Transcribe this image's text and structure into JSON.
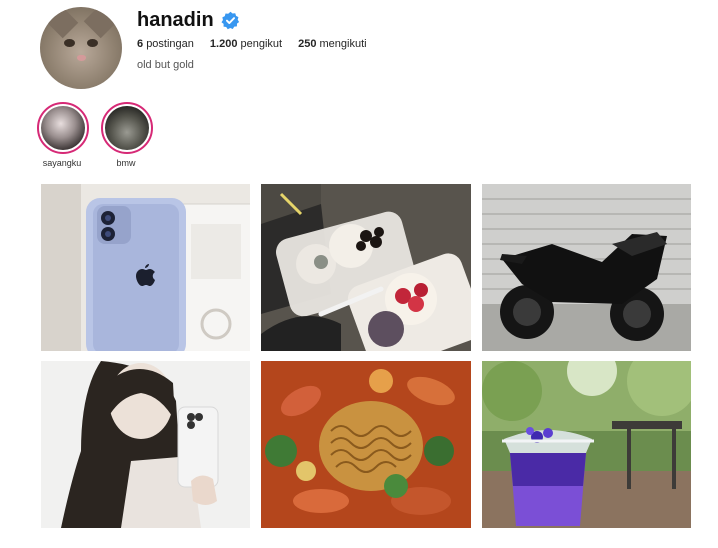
{
  "profile": {
    "username": "hanadin",
    "verified": true,
    "posts_count": "6",
    "posts_label": "postingan",
    "followers_count": "1.200",
    "followers_label": "pengikut",
    "following_count": "250",
    "following_label": "mengikuti",
    "bio": "old but gold"
  },
  "highlights": [
    {
      "label": "sayangku"
    },
    {
      "label": "bmw"
    }
  ],
  "posts": [
    {
      "subject": "iphone-in-box"
    },
    {
      "subject": "mochi-desserts"
    },
    {
      "subject": "black-motorcycle"
    },
    {
      "subject": "mirror-selfie"
    },
    {
      "subject": "spicy-noodles"
    },
    {
      "subject": "purple-drink"
    }
  ],
  "colors": {
    "verified_badge": "#3897f0",
    "highlight_ring": "#d62976",
    "text_primary": "#262626",
    "text_secondary": "#555555"
  }
}
